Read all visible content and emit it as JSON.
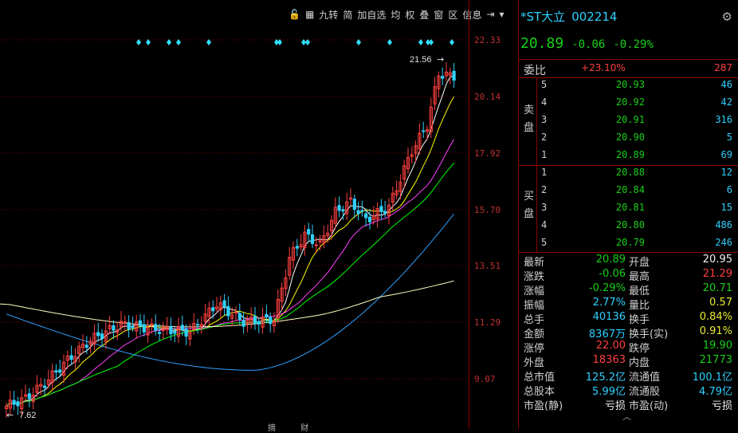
{
  "toolbar": {
    "items": [
      "九转",
      "简",
      "加自选",
      "均",
      "权",
      "叠",
      "窗",
      "区",
      "信息"
    ]
  },
  "price_axis": [
    "22.33",
    "20.14",
    "17.92",
    "15.70",
    "13.51",
    "11.29",
    "9.07"
  ],
  "chart_labels": {
    "high": "21.56",
    "low": "7.62"
  },
  "header": {
    "title": "*ST大立",
    "code": "002214",
    "price": "20.89",
    "change": "-0.06",
    "change_pct": "-0.29%"
  },
  "weibi": {
    "label": "委比",
    "pct": "+23.10%",
    "diff": "287"
  },
  "order_book": {
    "sell_label": "卖盘",
    "buy_label": "买盘",
    "sell": [
      {
        "level": "5",
        "price": "20.93",
        "volume": "46"
      },
      {
        "level": "4",
        "price": "20.92",
        "volume": "42"
      },
      {
        "level": "3",
        "price": "20.91",
        "volume": "316"
      },
      {
        "level": "2",
        "price": "20.90",
        "volume": "5"
      },
      {
        "level": "1",
        "price": "20.89",
        "volume": "69"
      }
    ],
    "buy": [
      {
        "level": "1",
        "price": "20.88",
        "volume": "12"
      },
      {
        "level": "2",
        "price": "20.84",
        "volume": "6"
      },
      {
        "level": "3",
        "price": "20.81",
        "volume": "15"
      },
      {
        "level": "4",
        "price": "20.80",
        "volume": "486"
      },
      {
        "level": "5",
        "price": "20.79",
        "volume": "246"
      }
    ]
  },
  "stats": [
    {
      "k1": "最新",
      "v1": "20.89",
      "c1": "green",
      "k2": "开盘",
      "v2": "20.95",
      "c2": "white"
    },
    {
      "k1": "涨跌",
      "v1": "-0.06",
      "c1": "green",
      "k2": "最高",
      "v2": "21.29",
      "c2": "red"
    },
    {
      "k1": "涨幅",
      "v1": "-0.29%",
      "c1": "green",
      "k2": "最低",
      "v2": "20.71",
      "c2": "green"
    },
    {
      "k1": "振幅",
      "v1": "2.77%",
      "c1": "cyan",
      "k2": "量比",
      "v2": "0.57",
      "c2": "yellow"
    },
    {
      "k1": "总手",
      "v1": "40136",
      "c1": "cyan",
      "k2": "换手",
      "v2": "0.84%",
      "c2": "yellow"
    },
    {
      "k1": "金额",
      "v1": "8367万",
      "c1": "cyan",
      "k2": "换手(实)",
      "v2": "0.91%",
      "c2": "yellow"
    },
    {
      "k1": "涨停",
      "v1": "22.00",
      "c1": "red",
      "k2": "跌停",
      "v2": "19.90",
      "c2": "green"
    },
    {
      "k1": "外盘",
      "v1": "18363",
      "c1": "red",
      "k2": "内盘",
      "v2": "21773",
      "c2": "green"
    },
    {
      "k1": "总市值",
      "v1": "125.2亿",
      "c1": "cyan",
      "k2": "流通值",
      "v2": "100.1亿",
      "c2": "cyan"
    },
    {
      "k1": "总股本",
      "v1": "5.99亿",
      "c1": "cyan",
      "k2": "流通股",
      "v2": "4.79亿",
      "c2": "cyan"
    },
    {
      "k1": "市盈(静)",
      "v1": "亏损",
      "c1": "white",
      "k2": "市盈(动)",
      "v2": "亏损",
      "c2": "white"
    }
  ],
  "bottom_tags": [
    "摘",
    "财"
  ],
  "colors": {
    "up": "#ff4040",
    "down": "#30d0ff",
    "grid": "#8b0000",
    "ma5": "#ffffff",
    "ma10": "#ffff00",
    "ma20": "#ff40ff",
    "ma30": "#00ff00",
    "ma60": "#30a0ff",
    "ma120": "#ffffc0"
  }
}
